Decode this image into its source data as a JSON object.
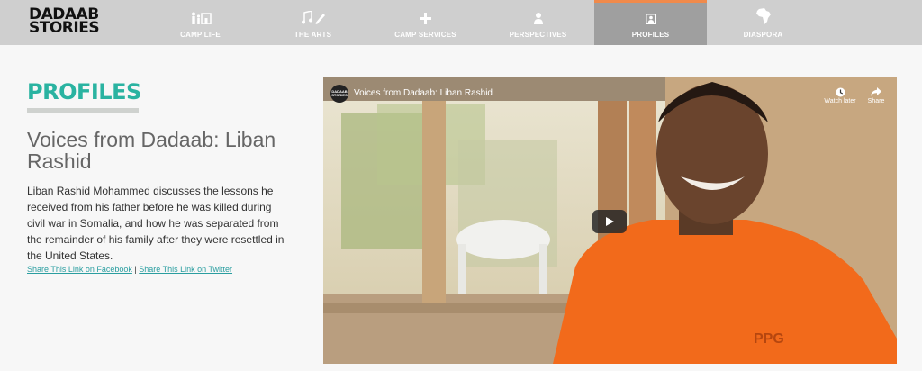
{
  "logo": {
    "line1": "DADAAB",
    "line2": "STORIES"
  },
  "nav": [
    {
      "label": "CAMP LIFE",
      "icon": "family-icon"
    },
    {
      "label": "THE ARTS",
      "icon": "music-pen-icon"
    },
    {
      "label": "CAMP SERVICES",
      "icon": "plus-icon"
    },
    {
      "label": "PERSPECTIVES",
      "icon": "person-icon"
    },
    {
      "label": "PROFILES",
      "icon": "profile-card-icon",
      "active": true
    },
    {
      "label": "DIASPORA",
      "icon": "africa-map-icon"
    }
  ],
  "section": {
    "title": "PROFILES"
  },
  "story": {
    "title": "Voices from Dadaab: Liban Rashid",
    "description": "Liban Rashid Mohammed discusses the lessons he received from his father before he was killed during civil war in Somalia, and how he was separated from the remainder of his family after they were resettled in the United States.",
    "share_facebook": "Share This Link on Facebook",
    "share_separator": "|",
    "share_twitter": "Share This Link on Twitter"
  },
  "video": {
    "channel_logo": "DADAAB STORIES",
    "title": "Voices from Dadaab: Liban Rashid",
    "watch_later": "Watch later",
    "share": "Share",
    "shirt_print": "PPG"
  },
  "colors": {
    "teal": "#2ab3a1",
    "nav_bg": "#cfcfcf",
    "nav_active": "#9f9f9f",
    "active_accent": "#f08a4b",
    "shirt": "#f26a1b"
  }
}
